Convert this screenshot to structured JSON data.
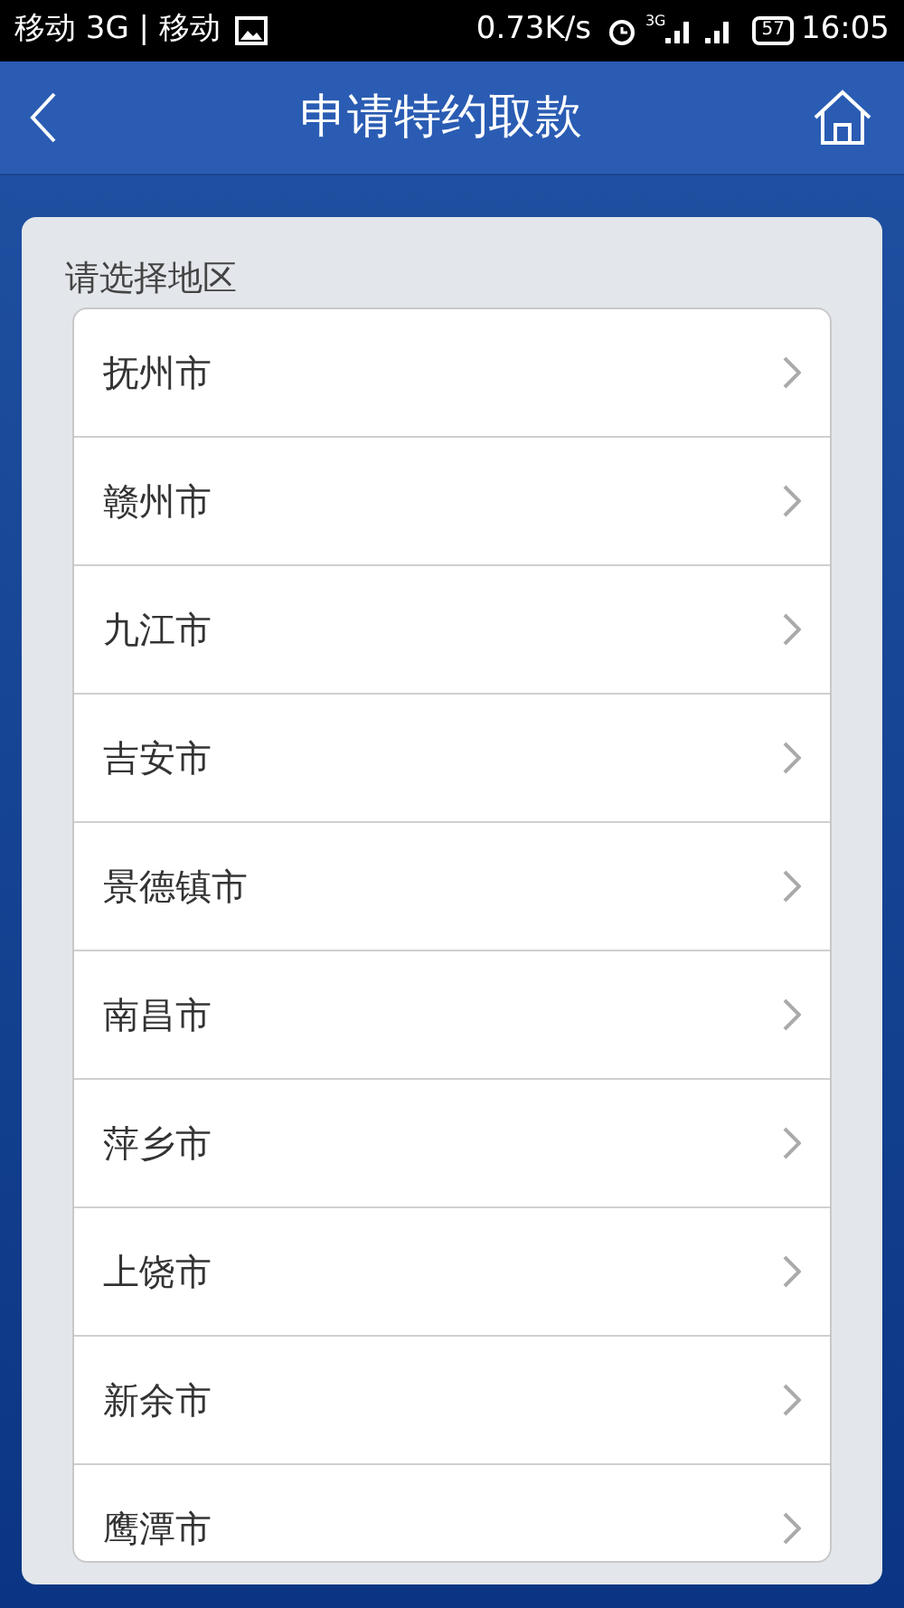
{
  "status_bar": {
    "carrier": "移动 3G | 移动",
    "speed": "0.73K/s",
    "network": "3G",
    "battery": "57",
    "time": "16:05"
  },
  "header": {
    "title": "申请特约取款"
  },
  "region_picker": {
    "label": "请选择地区",
    "items": [
      {
        "name": "抚州市"
      },
      {
        "name": "赣州市"
      },
      {
        "name": "九江市"
      },
      {
        "name": "吉安市"
      },
      {
        "name": "景德镇市"
      },
      {
        "name": "南昌市"
      },
      {
        "name": "萍乡市"
      },
      {
        "name": "上饶市"
      },
      {
        "name": "新余市"
      },
      {
        "name": "鹰潭市"
      }
    ]
  }
}
